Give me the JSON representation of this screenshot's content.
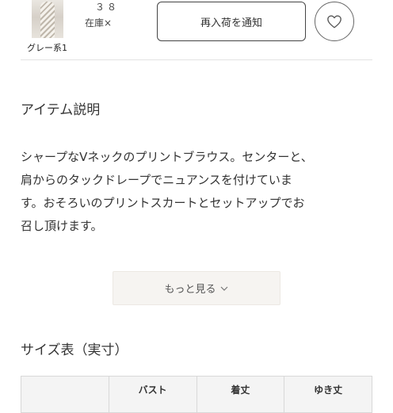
{
  "variant": {
    "color_label": "グレー系1",
    "size": "３８",
    "stock": "在庫×",
    "notify_button": "再入荷を通知",
    "favorite_icon": "heart-icon"
  },
  "item_description": {
    "title": "アイテム説明",
    "lines": [
      "シャープなVネックのプリントブラウス。センターと、",
      "肩からのタックドレープでニュアンスを付けていま",
      "す。おそろいのプリントスカートとセットアップでお",
      "召し頂けます。"
    ],
    "more_button": "もっと見る"
  },
  "size_chart": {
    "title": "サイズ表（実寸）",
    "headers": [
      "",
      "バスト",
      "着丈",
      "ゆき丈"
    ]
  }
}
